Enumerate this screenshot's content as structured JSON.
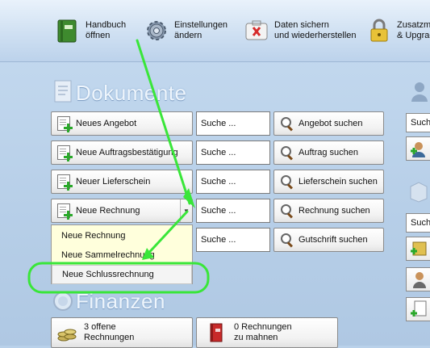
{
  "toolbar": {
    "items": [
      {
        "line1": "Handbuch",
        "line2": "öffnen",
        "icon": "book-icon"
      },
      {
        "line1": "Einstellungen",
        "line2": "ändern",
        "icon": "gear-icon"
      },
      {
        "line1": "Daten sichern",
        "line2": "und wiederherstellen",
        "icon": "first-aid-icon"
      },
      {
        "line1": "Zusatzm",
        "line2": "& Upgrad",
        "icon": "lock-icon"
      }
    ]
  },
  "dokumente": {
    "title": "Dokumente",
    "rows": [
      {
        "new_label": "Neues Angebot",
        "search_placeholder": "Suche ...",
        "search_button": "Angebot suchen"
      },
      {
        "new_label": "Neue Auftragsbestätigung",
        "search_placeholder": "Suche ...",
        "search_button": "Auftrag suchen"
      },
      {
        "new_label": "Neuer Lieferschein",
        "search_placeholder": "Suche ...",
        "search_button": "Lieferschein suchen"
      },
      {
        "new_label": "Neue Rechnung",
        "search_placeholder": "Suche ...",
        "search_button": "Rechnung suchen"
      },
      {
        "new_label": "",
        "search_placeholder": "Suche ...",
        "search_button": "Gutschrift suchen"
      }
    ],
    "dropdown_menu": [
      "Neue Rechnung",
      "Neue Sammelrechnung",
      "Neue Schlussrechnung"
    ]
  },
  "finanzen": {
    "title": "Finanzen",
    "buttons": [
      {
        "line1": "3 offene",
        "line2": "Rechnungen"
      },
      {
        "line1": "0 Rechnungen",
        "line2": "zu mahnen"
      }
    ]
  },
  "right_column": {
    "search1": "Such",
    "search2": "Such"
  },
  "colors": {
    "background": "#b9d1ea",
    "annotation_arrow": "#39e639",
    "menu_background": "#ffffdc"
  }
}
